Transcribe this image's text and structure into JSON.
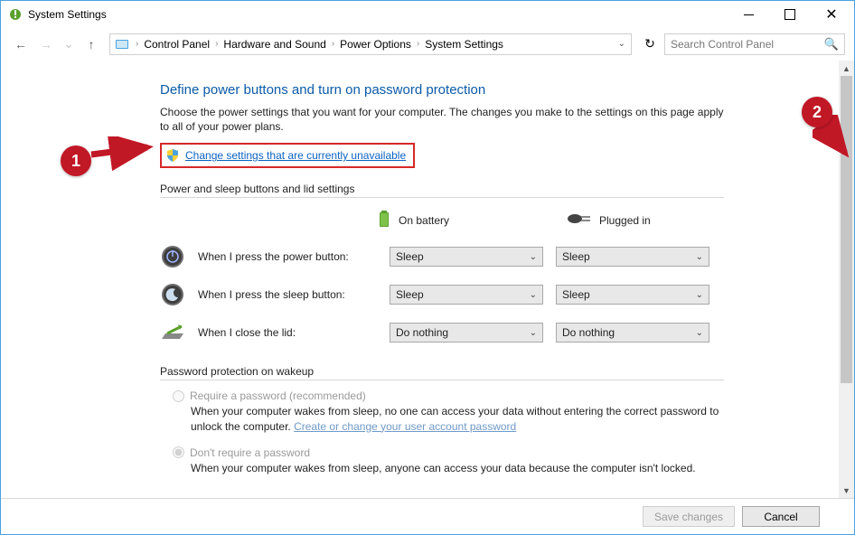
{
  "window": {
    "title": "System Settings"
  },
  "breadcrumb": {
    "items": [
      "Control Panel",
      "Hardware and Sound",
      "Power Options",
      "System Settings"
    ]
  },
  "search": {
    "placeholder": "Search Control Panel"
  },
  "page": {
    "heading": "Define power buttons and turn on password protection",
    "description": "Choose the power settings that you want for your computer. The changes you make to the settings on this page apply to all of your power plans.",
    "change_link": "Change settings that are currently unavailable",
    "section_buttons": "Power and sleep buttons and lid settings",
    "col_battery": "On battery",
    "col_plugged": "Plugged in",
    "rows": [
      {
        "label": "When I press the power button:",
        "battery": "Sleep",
        "plugged": "Sleep"
      },
      {
        "label": "When I press the sleep button:",
        "battery": "Sleep",
        "plugged": "Sleep"
      },
      {
        "label": "When I close the lid:",
        "battery": "Do nothing",
        "plugged": "Do nothing"
      }
    ],
    "section_pw": "Password protection on wakeup",
    "pw_require": {
      "label": "Require a password (recommended)",
      "desc": "When your computer wakes from sleep, no one can access your data without entering the correct password to unlock the computer. ",
      "link": "Create or change your user account password"
    },
    "pw_dont": {
      "label": "Don't require a password",
      "desc": "When your computer wakes from sleep, anyone can access your data because the computer isn't locked."
    }
  },
  "footer": {
    "save": "Save changes",
    "cancel": "Cancel"
  },
  "annotations": {
    "a1": "1",
    "a2": "2"
  }
}
